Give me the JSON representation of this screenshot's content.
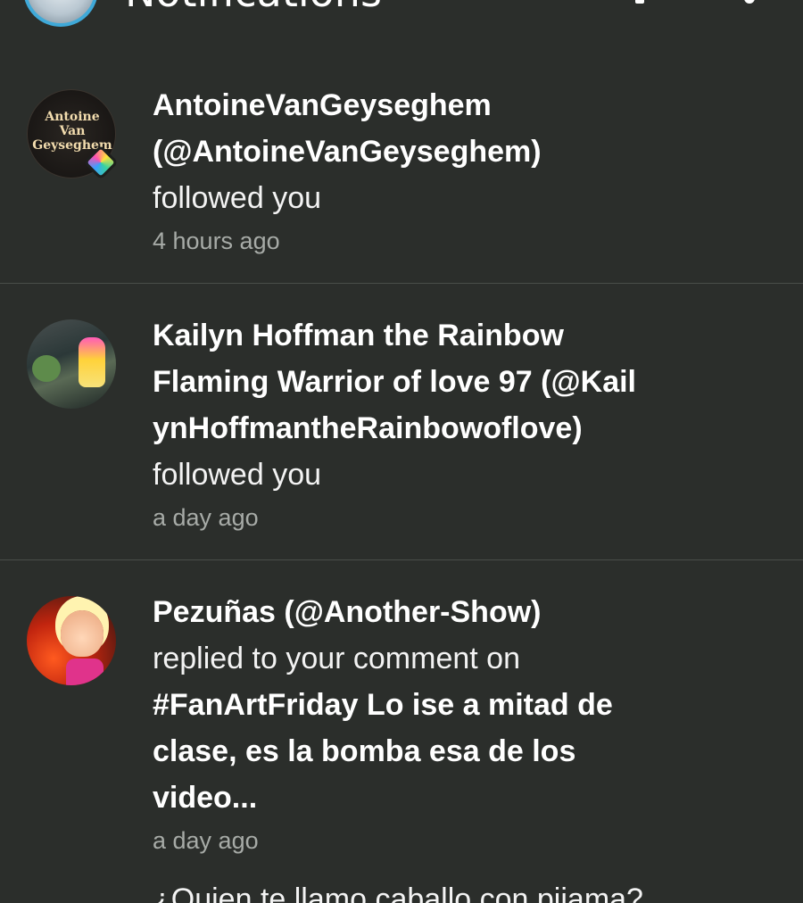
{
  "header": {
    "title": "Notifications",
    "avatar_icon": "profile-avatar",
    "search_icon": "search-icon",
    "menu_icon": "more-vertical-icon"
  },
  "notifications": [
    {
      "avatar_label": [
        "Antoine",
        "Van",
        "Geyseghem"
      ],
      "name_lines": [
        "AntoineVanGeyseghem",
        "(@AntoineVanGeyseghem)"
      ],
      "action": "followed you",
      "time": "4 hours ago"
    },
    {
      "name_lines": [
        "Kailyn Hoffman the Rainbow",
        "Flaming Warrior of love 97 (@Kail",
        "ynHoffmantheRainbowoflove)"
      ],
      "action": "followed you",
      "time": "a day ago"
    },
    {
      "name_lines": [
        "Pezuñas (@Another-Show)"
      ],
      "action": "replied to your comment on",
      "post_lines": [
        "#FanArtFriday Lo ise a mitad de",
        "clase, es la bomba esa de los",
        "video..."
      ],
      "time": "a day ago"
    }
  ],
  "next_preview": "¿Quien te llamo caballo con pijama?"
}
